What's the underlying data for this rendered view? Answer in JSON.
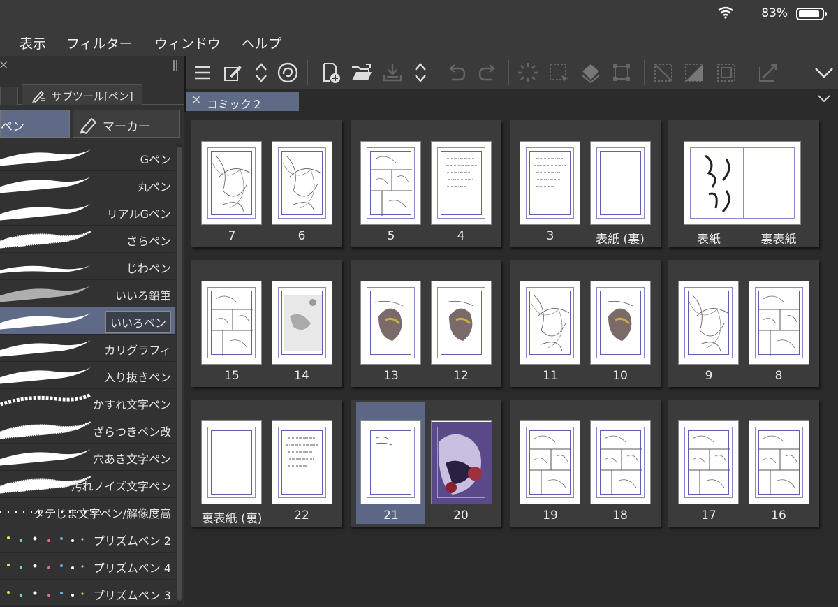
{
  "status": {
    "battery": "83%"
  },
  "menu": [
    "表示",
    "フィルター",
    "ウィンドウ",
    "ヘルプ"
  ],
  "left": {
    "tab_label": "サブツール[ペン]",
    "sub_tabs": [
      "ペン",
      "マーカー"
    ],
    "brushes": [
      {
        "name": "Gペン",
        "style": "solid"
      },
      {
        "name": "丸ペン",
        "style": "solid"
      },
      {
        "name": "リアルGペン",
        "style": "solid"
      },
      {
        "name": "さらペン",
        "style": "rough"
      },
      {
        "name": "じわペン",
        "style": "thin"
      },
      {
        "name": "いいろ鉛筆",
        "style": "pencil"
      },
      {
        "name": "いいろペン",
        "style": "solid",
        "selected": true
      },
      {
        "name": "カリグラフィ",
        "style": "solid"
      },
      {
        "name": "入り抜きペン",
        "style": "solid"
      },
      {
        "name": "かすれ文字ペン",
        "style": "dry"
      },
      {
        "name": "ざらつきペン改",
        "style": "rough"
      },
      {
        "name": "穴あき文字ペン",
        "style": "solid"
      },
      {
        "name": "汚れノイズ文字ペン",
        "style": "rough"
      },
      {
        "name": "タテじま文字ペン/解像度高",
        "style": "dots"
      },
      {
        "name": "プリズムペン 2",
        "style": "prism"
      },
      {
        "name": "プリズムペン 4",
        "style": "prism"
      },
      {
        "name": "プリズムペン 3",
        "style": "prism"
      }
    ]
  },
  "toolbar": {
    "icons": [
      "menu-icon",
      "edit-icon",
      "up-down-arrows-icon",
      "spiral-icon",
      "new-page-icon",
      "open-folder-icon",
      "save-icon",
      "up-down-arrows-icon",
      "undo-icon",
      "redo-icon",
      "loading-icon",
      "select-icon",
      "fill-icon",
      "transform-icon",
      "deselect-icon",
      "invert-selection-icon",
      "selection-border-icon",
      "arrow-icon",
      "chevron-down-icon"
    ]
  },
  "document_tab": "コミック２",
  "spreads": [
    {
      "pages": [
        {
          "label": "7",
          "content": "sketch"
        },
        {
          "label": "6",
          "content": "sketch"
        }
      ]
    },
    {
      "pages": [
        {
          "label": "5",
          "content": "panels"
        },
        {
          "label": "4",
          "content": "text"
        }
      ]
    },
    {
      "pages": [
        {
          "label": "3",
          "content": "text"
        },
        {
          "label": "表紙 (裏)",
          "content": "blank"
        }
      ]
    },
    {
      "wide": true,
      "pages": [
        {
          "label": "表紙",
          "content": "calligraphy"
        },
        {
          "label": "裏表紙",
          "content": "blank"
        }
      ]
    },
    {
      "pages": [
        {
          "label": "15",
          "content": "panels"
        },
        {
          "label": "14",
          "content": "gray"
        }
      ]
    },
    {
      "pages": [
        {
          "label": "13",
          "content": "color"
        },
        {
          "label": "12",
          "content": "color"
        }
      ]
    },
    {
      "pages": [
        {
          "label": "11",
          "content": "sketch"
        },
        {
          "label": "10",
          "content": "color"
        }
      ]
    },
    {
      "pages": [
        {
          "label": "9",
          "content": "sketch"
        },
        {
          "label": "8",
          "content": "panels"
        }
      ]
    },
    {
      "pages": [
        {
          "label": "裏表紙 (裏)",
          "content": "blank"
        },
        {
          "label": "22",
          "content": "text"
        }
      ]
    },
    {
      "selected": 0,
      "pages": [
        {
          "label": "21",
          "content": "note"
        },
        {
          "label": "20",
          "content": "fullcolor"
        }
      ]
    },
    {
      "pages": [
        {
          "label": "19",
          "content": "panels"
        },
        {
          "label": "18",
          "content": "panels"
        }
      ]
    },
    {
      "pages": [
        {
          "label": "17",
          "content": "panels"
        },
        {
          "label": "16",
          "content": "panels"
        }
      ]
    }
  ]
}
